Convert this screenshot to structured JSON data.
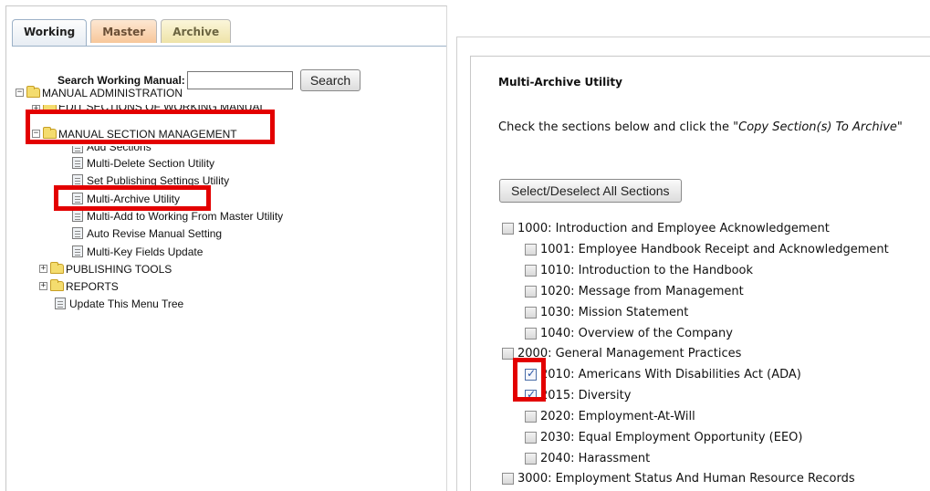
{
  "tabs": [
    {
      "label": "Working"
    },
    {
      "label": "Master"
    },
    {
      "label": "Archive"
    }
  ],
  "search": {
    "label": "Search Working Manual:",
    "value": "",
    "button": "Search"
  },
  "tree": {
    "manual_admin": "MANUAL ADMINISTRATION",
    "edit_sections": "EDIT SECTIONS OF WORKING MANUAL",
    "section_mgmt": "MANUAL SECTION MANAGEMENT",
    "add_sections": "Add Sections",
    "multi_delete": "Multi-Delete Section Utility",
    "set_publishing": "Set Publishing Settings Utility",
    "multi_archive": "Multi-Archive Utility",
    "multi_add": "Multi-Add to Working From Master Utility",
    "auto_revise": "Auto Revise Manual Setting",
    "multi_key": "Multi-Key Fields Update",
    "publishing_tools": "PUBLISHING TOOLS",
    "reports": "REPORTS",
    "update_tree": "Update This Menu Tree",
    "expand": "+",
    "collapse": "−"
  },
  "panel": {
    "title": "Multi-Archive Utility",
    "instruction_prefix": "Check the sections below and click the ",
    "instruction_em": "\"Copy Section(s) To Archive\"",
    "select_all_button": "Select/Deselect All Sections"
  },
  "sections": [
    {
      "label": "1000: Introduction and Employee Acknowledgement",
      "checked": false
    },
    {
      "label": "1001: Employee Handbook Receipt and Acknowledgement",
      "checked": false
    },
    {
      "label": "1010: Introduction to the Handbook",
      "checked": false
    },
    {
      "label": "1020: Message from Management",
      "checked": false
    },
    {
      "label": "1030: Mission Statement",
      "checked": false
    },
    {
      "label": "1040: Overview of the Company",
      "checked": false
    },
    {
      "label": "2000: General Management Practices",
      "checked": false
    },
    {
      "label": "2010: Americans With Disabilities Act (ADA)",
      "checked": true
    },
    {
      "label": "2015: Diversity",
      "checked": true
    },
    {
      "label": "2020: Employment-At-Will",
      "checked": false
    },
    {
      "label": "2030: Equal Employment Opportunity (EEO)",
      "checked": false
    },
    {
      "label": "2040: Harassment",
      "checked": false
    },
    {
      "label": "3000: Employment Status And Human Resource Records",
      "checked": false
    }
  ],
  "colors": {
    "highlight": "#e30000",
    "tab_working": "#e6ecf3",
    "tab_master": "#f7c79a",
    "tab_archive": "#eee3a8"
  }
}
